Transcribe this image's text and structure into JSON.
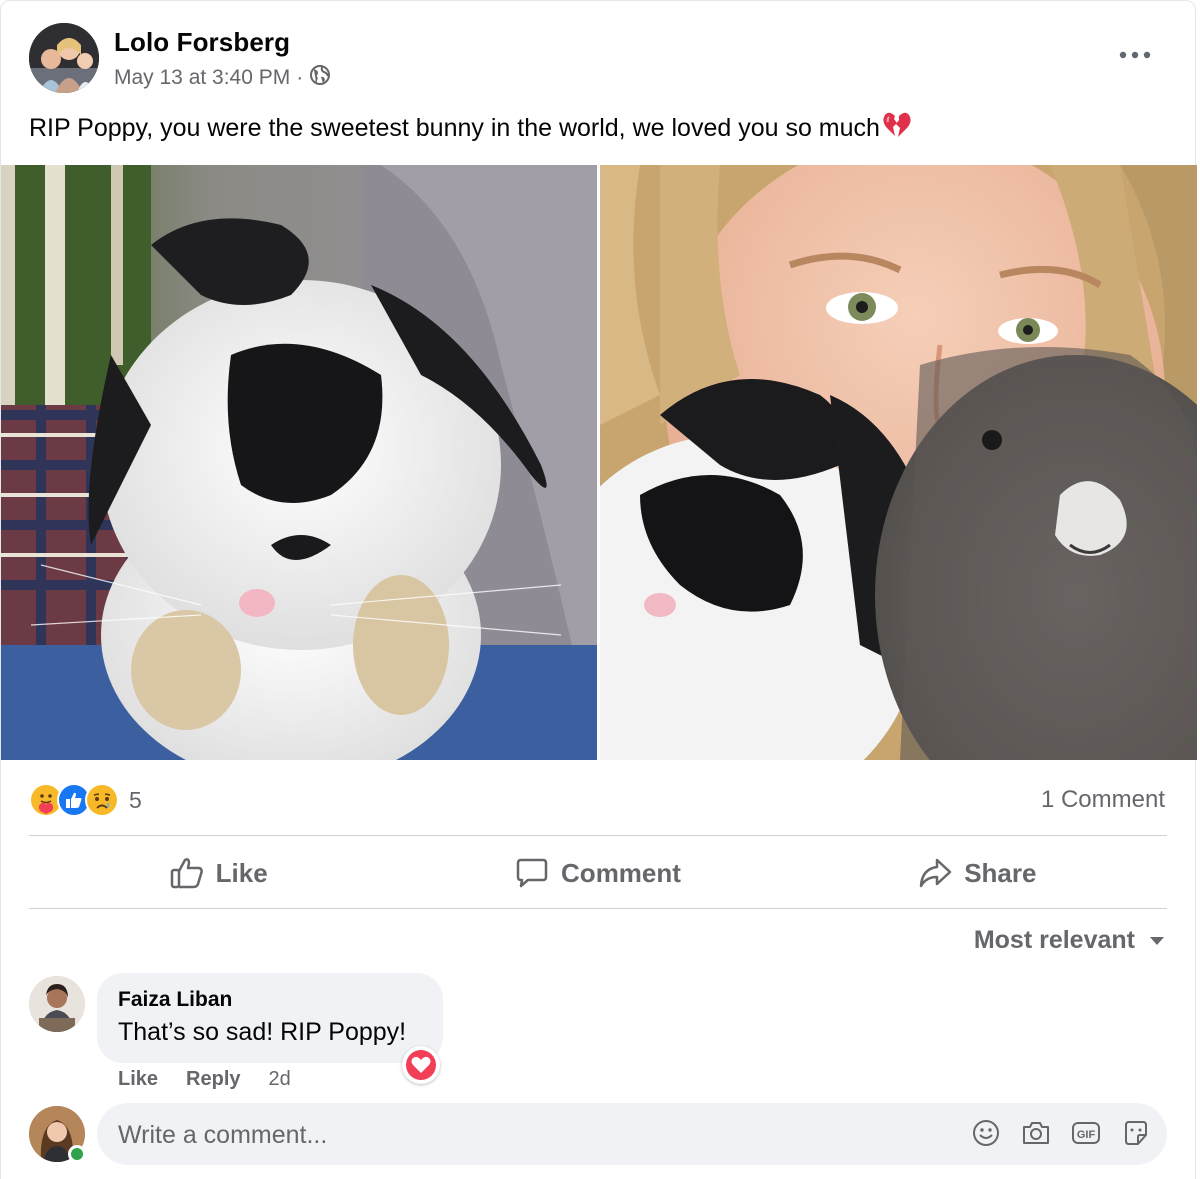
{
  "post": {
    "author": "Lolo Forsberg",
    "timestamp": "May 13 at 3:40 PM",
    "separator": "·",
    "audience_icon": "globe-icon",
    "text": "RIP Poppy, you were the sweetest bunny in the world, we loved you so much",
    "text_emoji": "broken-heart-emoji"
  },
  "reactions": {
    "icons": [
      "care-reaction",
      "like-reaction",
      "sad-reaction"
    ],
    "count": "5",
    "comments_label": "1 Comment"
  },
  "actions": {
    "like": "Like",
    "comment": "Comment",
    "share": "Share"
  },
  "sort_label": "Most relevant",
  "comments": [
    {
      "author": "Faiza Liban",
      "text": "That’s so sad! RIP Poppy!",
      "reaction": "love-reaction",
      "like_label": "Like",
      "reply_label": "Reply",
      "time": "2d"
    }
  ],
  "composer": {
    "placeholder": "Write a comment...",
    "icons": [
      "emoji-icon",
      "camera-icon",
      "gif-icon",
      "sticker-icon"
    ]
  },
  "colors": {
    "secondary_text": "#65676b",
    "bubble_bg": "#f0f2f5",
    "like_blue": "#1877f2",
    "love_red": "#f33e58",
    "online_green": "#31a24c"
  }
}
